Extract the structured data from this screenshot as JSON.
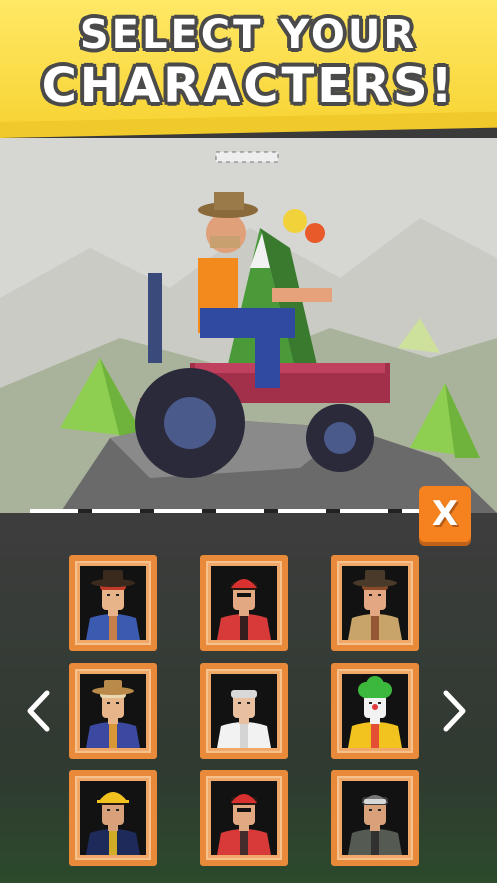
{
  "header": {
    "title_line1": "SELECT YOUR",
    "title_line2": "CHARACTERS!"
  },
  "controls": {
    "close_label": "X",
    "prev_icon": "chevron-left-icon",
    "next_icon": "chevron-right-icon"
  },
  "characters": [
    {
      "id": "farmer-girl",
      "hat": "cowboy",
      "hat_color": "#3a2a1e",
      "hair": "#c23a2a",
      "skin": "#e7b48a",
      "shirt": "#3b5bb0",
      "accent": "#e2873a"
    },
    {
      "id": "biker-red",
      "hat": "helmet",
      "hat_color": "#d93030",
      "hair": "#2a1a12",
      "skin": "#e0a981",
      "shirt": "#d83a3a",
      "accent": "#1a1a1a"
    },
    {
      "id": "bearded-cowboy",
      "hat": "cowboy",
      "hat_color": "#4a3a2a",
      "hair": "#8a4a2a",
      "skin": "#e3a783",
      "shirt": "#c9a46a",
      "accent": "#8a4a2a"
    },
    {
      "id": "old-farmer",
      "hat": "straw",
      "hat_color": "#b98a4a",
      "hair": "#e8d8b0",
      "skin": "#e8b48a",
      "shirt": "#3b4aa0",
      "accent": "#f5a623"
    },
    {
      "id": "grandma",
      "hat": "none",
      "hat_color": "#cfcfcf",
      "hair": "#d8d8d8",
      "skin": "#e8c0a0",
      "shirt": "#f2f2f2",
      "accent": "#cfcfcf"
    },
    {
      "id": "clown",
      "hat": "afro",
      "hat_color": "#3cb83c",
      "hair": "#3cb83c",
      "skin": "#f2f2f2",
      "shirt": "#f2c21e",
      "accent": "#e23a3a"
    },
    {
      "id": "firefighter",
      "hat": "hardhat",
      "hat_color": "#f2c21e",
      "hair": "#2a1a12",
      "skin": "#d9a17a",
      "shirt": "#1e2a5a",
      "accent": "#f2c21e"
    },
    {
      "id": "racer-red",
      "hat": "helmet",
      "hat_color": "#d93030",
      "hair": "#2a1a12",
      "skin": "#e0a981",
      "shirt": "#d83a3a",
      "accent": "#2a2a2a"
    },
    {
      "id": "soldier",
      "hat": "goggles",
      "hat_color": "#d8d8d8",
      "hair": "#3a3a3a",
      "skin": "#d9a17a",
      "shirt": "#555a52",
      "accent": "#2a2a2a"
    }
  ]
}
